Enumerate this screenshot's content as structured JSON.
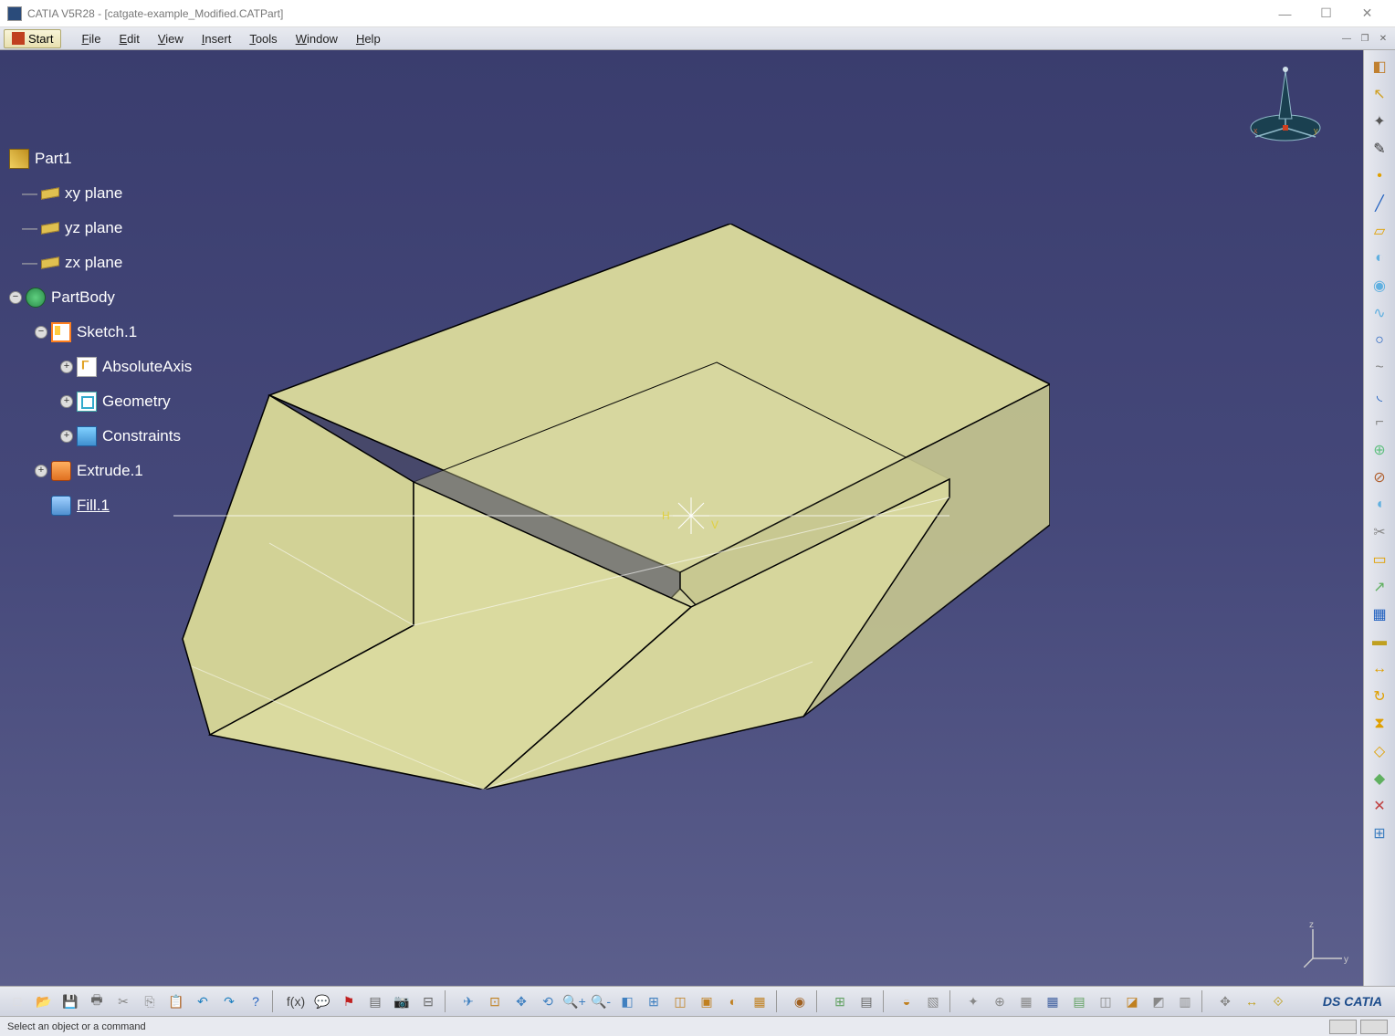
{
  "titlebar": {
    "app_title": "CATIA V5R28 - [catgate-example_Modified.CATPart]"
  },
  "menubar": {
    "start": "Start",
    "items": [
      "File",
      "Edit",
      "View",
      "Insert",
      "Tools",
      "Window",
      "Help"
    ]
  },
  "tree": {
    "root": "Part1",
    "planes": [
      "xy plane",
      "yz plane",
      "zx plane"
    ],
    "body": "PartBody",
    "sketch": "Sketch.1",
    "sketch_children": [
      "AbsoluteAxis",
      "Geometry",
      "Constraints"
    ],
    "features": [
      "Extrude.1",
      "Fill.1"
    ]
  },
  "right_tools": [
    {
      "name": "workbench-icon",
      "glyph": "◧",
      "color": "#c08030"
    },
    {
      "name": "select-arrow-icon",
      "glyph": "↖",
      "color": "#d0a020"
    },
    {
      "name": "compass-icon",
      "glyph": "✦",
      "color": "#555"
    },
    {
      "name": "sketch-icon",
      "glyph": "✎",
      "color": "#333"
    },
    {
      "name": "point-icon",
      "glyph": "•",
      "color": "#e0a000"
    },
    {
      "name": "line-icon",
      "glyph": "╱",
      "color": "#2060c0"
    },
    {
      "name": "plane-icon",
      "glyph": "▱",
      "color": "#e0a000"
    },
    {
      "name": "extrude-icon",
      "glyph": "◐",
      "color": "#60b0e0"
    },
    {
      "name": "revolve-icon",
      "glyph": "◉",
      "color": "#60b0e0"
    },
    {
      "name": "sweep-icon",
      "glyph": "∿",
      "color": "#60b0e0"
    },
    {
      "name": "circle-icon",
      "glyph": "○",
      "color": "#2060c0"
    },
    {
      "name": "spline-icon",
      "glyph": "~",
      "color": "#888"
    },
    {
      "name": "arc-icon",
      "glyph": "◟",
      "color": "#2060c0"
    },
    {
      "name": "corner-icon",
      "glyph": "⌐",
      "color": "#888"
    },
    {
      "name": "join-icon",
      "glyph": "⊕",
      "color": "#60c080"
    },
    {
      "name": "split-icon",
      "glyph": "⊘",
      "color": "#b06030"
    },
    {
      "name": "fillet-icon",
      "glyph": "◖",
      "color": "#60b0e0"
    },
    {
      "name": "trim-icon",
      "glyph": "✂",
      "color": "#888"
    },
    {
      "name": "boundary-icon",
      "glyph": "▭",
      "color": "#e0a000"
    },
    {
      "name": "extrapolate-icon",
      "glyph": "↗",
      "color": "#60b060"
    },
    {
      "name": "pattern-icon",
      "glyph": "▦",
      "color": "#2060c0"
    },
    {
      "name": "thick-icon",
      "glyph": "▬",
      "color": "#c0a020"
    },
    {
      "name": "translate-icon",
      "glyph": "↔",
      "color": "#e0a000"
    },
    {
      "name": "rotate-icon",
      "glyph": "↻",
      "color": "#e0a000"
    },
    {
      "name": "symmetry-icon",
      "glyph": "⧗",
      "color": "#e0a000"
    },
    {
      "name": "scale-icon",
      "glyph": "◇",
      "color": "#e0a000"
    },
    {
      "name": "affinity-icon",
      "glyph": "◆",
      "color": "#60b060"
    },
    {
      "name": "axis-transform-icon",
      "glyph": "✕",
      "color": "#c04040"
    },
    {
      "name": "measure-icon",
      "glyph": "⊞",
      "color": "#4080c0"
    }
  ],
  "bottom_tools": [
    {
      "name": "new-icon",
      "glyph": "□",
      "color": "#ddd"
    },
    {
      "name": "open-icon",
      "glyph": "📂",
      "color": "#e0b040"
    },
    {
      "name": "save-icon",
      "glyph": "💾",
      "color": "#4060a0"
    },
    {
      "name": "print-icon",
      "glyph": "🖶",
      "color": "#666"
    },
    {
      "name": "cut-icon",
      "glyph": "✂",
      "color": "#888"
    },
    {
      "name": "copy-icon",
      "glyph": "⎘",
      "color": "#888"
    },
    {
      "name": "paste-icon",
      "glyph": "📋",
      "color": "#c09040"
    },
    {
      "name": "undo-icon",
      "glyph": "↶",
      "color": "#2080c0"
    },
    {
      "name": "redo-icon",
      "glyph": "↷",
      "color": "#2080c0"
    },
    {
      "name": "help-icon",
      "glyph": "?",
      "color": "#2060c0"
    },
    {
      "name": "sep"
    },
    {
      "name": "formula-icon",
      "glyph": "f(x)",
      "color": "#444"
    },
    {
      "name": "comment-icon",
      "glyph": "💬",
      "color": "#888"
    },
    {
      "name": "flag-icon",
      "glyph": "⚑",
      "color": "#c02020"
    },
    {
      "name": "catalog-icon",
      "glyph": "▤",
      "color": "#666"
    },
    {
      "name": "capture-icon",
      "glyph": "📷",
      "color": "#666"
    },
    {
      "name": "db-icon",
      "glyph": "⊟",
      "color": "#666"
    },
    {
      "name": "sep"
    },
    {
      "name": "fly-icon",
      "glyph": "✈",
      "color": "#4080c0"
    },
    {
      "name": "fit-icon",
      "glyph": "⊡",
      "color": "#c08020"
    },
    {
      "name": "pan-icon",
      "glyph": "✥",
      "color": "#4080c0"
    },
    {
      "name": "rotate-view-icon",
      "glyph": "⟲",
      "color": "#4080c0"
    },
    {
      "name": "zoom-in-icon",
      "glyph": "🔍+",
      "color": "#4080c0"
    },
    {
      "name": "zoom-out-icon",
      "glyph": "🔍-",
      "color": "#4080c0"
    },
    {
      "name": "normal-view-icon",
      "glyph": "◧",
      "color": "#4080c0"
    },
    {
      "name": "multi-view-icon",
      "glyph": "⊞",
      "color": "#4080c0"
    },
    {
      "name": "iso-view-icon",
      "glyph": "◫",
      "color": "#c08020"
    },
    {
      "name": "shading-icon",
      "glyph": "▣",
      "color": "#c08020"
    },
    {
      "name": "hide-show-icon",
      "glyph": "◐",
      "color": "#c08020"
    },
    {
      "name": "swap-space-icon",
      "glyph": "▦",
      "color": "#c08020"
    },
    {
      "name": "sep"
    },
    {
      "name": "render-icon",
      "glyph": "◉",
      "color": "#a06020"
    },
    {
      "name": "sep"
    },
    {
      "name": "sketch-pos-icon",
      "glyph": "⊞",
      "color": "#60a060"
    },
    {
      "name": "sketch-analysis-icon",
      "glyph": "▤",
      "color": "#666"
    },
    {
      "name": "sep"
    },
    {
      "name": "material-icon",
      "glyph": "◒",
      "color": "#c08020"
    },
    {
      "name": "texture-icon",
      "glyph": "▧",
      "color": "#888"
    },
    {
      "name": "sep"
    },
    {
      "name": "axis-sys-icon",
      "glyph": "✦",
      "color": "#888"
    },
    {
      "name": "origin-icon",
      "glyph": "⊕",
      "color": "#888"
    },
    {
      "name": "grid3-icon",
      "glyph": "▦",
      "color": "#888"
    },
    {
      "name": "grid-icon",
      "glyph": "▦",
      "color": "#4060a0"
    },
    {
      "name": "working-sup-icon",
      "glyph": "▤",
      "color": "#60a060"
    },
    {
      "name": "snap-icon",
      "glyph": "◫",
      "color": "#888"
    },
    {
      "name": "create-datum-icon",
      "glyph": "◪",
      "color": "#c08020"
    },
    {
      "name": "insert-mode-icon",
      "glyph": "◩",
      "color": "#888"
    },
    {
      "name": "temp-analysis-icon",
      "glyph": "▥",
      "color": "#888"
    },
    {
      "name": "sep"
    },
    {
      "name": "manip-icon",
      "glyph": "✥",
      "color": "#888"
    },
    {
      "name": "measure-between-icon",
      "glyph": "↔",
      "color": "#c0a020"
    },
    {
      "name": "measure-item-icon",
      "glyph": "⟐",
      "color": "#c0a020"
    }
  ],
  "statusbar": {
    "message": "Select an object or a command"
  },
  "logo_text": "DS CATIA"
}
